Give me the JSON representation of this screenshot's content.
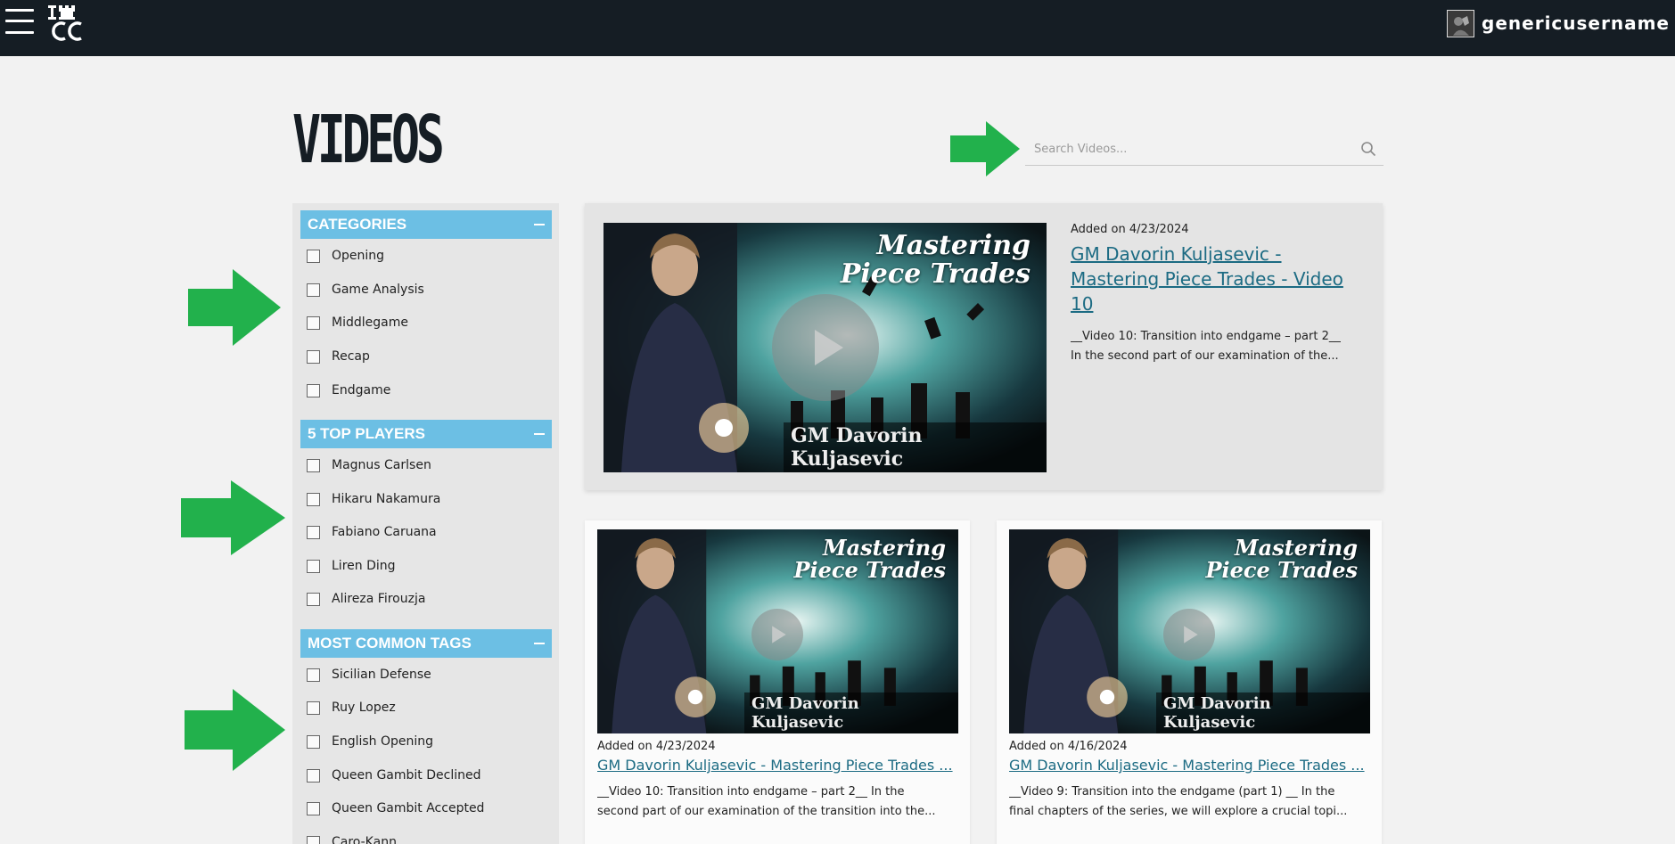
{
  "header": {
    "logo_text": "ICC",
    "username": "genericusername"
  },
  "page": {
    "title": "VIDEOS"
  },
  "search": {
    "placeholder": "Search Videos..."
  },
  "sidebar": {
    "sections": [
      {
        "title": "CATEGORIES",
        "items": [
          "Opening",
          "Game Analysis",
          "Middlegame",
          "Recap",
          "Endgame"
        ]
      },
      {
        "title": "5 TOP PLAYERS",
        "items": [
          "Magnus Carlsen",
          "Hikaru Nakamura",
          "Fabiano Caruana",
          "Liren Ding",
          "Alireza Firouzja"
        ]
      },
      {
        "title": "MOST COMMON TAGS",
        "items": [
          "Sicilian Defense",
          "Ruy Lopez",
          "English Opening",
          "Queen Gambit Declined",
          "Queen Gambit Accepted",
          "Caro-Kann"
        ]
      }
    ]
  },
  "thumbnail": {
    "line1": "Mastering",
    "line2": "Piece Trades",
    "name": "GM Davorin Kuljasevic"
  },
  "featured": {
    "added": "Added on 4/23/2024",
    "title": "GM Davorin Kuljasevic - Mastering Piece Trades - Video 10",
    "desc_line1": "__Video 10: Transition into endgame – part 2__",
    "desc_line2": "In the second part of our examination of the..."
  },
  "videos": [
    {
      "added": "Added on 4/23/2024",
      "title": "GM Davorin Kuljasevic - Mastering Piece Trades ...",
      "desc_line1": "__Video 10: Transition into endgame – part 2__ In the",
      "desc_line2": "second part of our examination of the transition into the..."
    },
    {
      "added": "Added on 4/16/2024",
      "title": "GM Davorin Kuljasevic - Mastering Piece Trades ...",
      "desc_line1": "__Video 9: Transition into the endgame (part 1) __ In the",
      "desc_line2": "final chapters of the series, we will explore a crucial topi..."
    }
  ],
  "colors": {
    "topbar": "#151d24",
    "section_header": "#6cbfe4",
    "link": "#1c6b83",
    "arrow": "#22b14c"
  },
  "icons": [
    "menu-icon",
    "logo-icon",
    "avatar-icon",
    "search-icon",
    "play-icon",
    "collapse-icon",
    "arrow-icon"
  ]
}
